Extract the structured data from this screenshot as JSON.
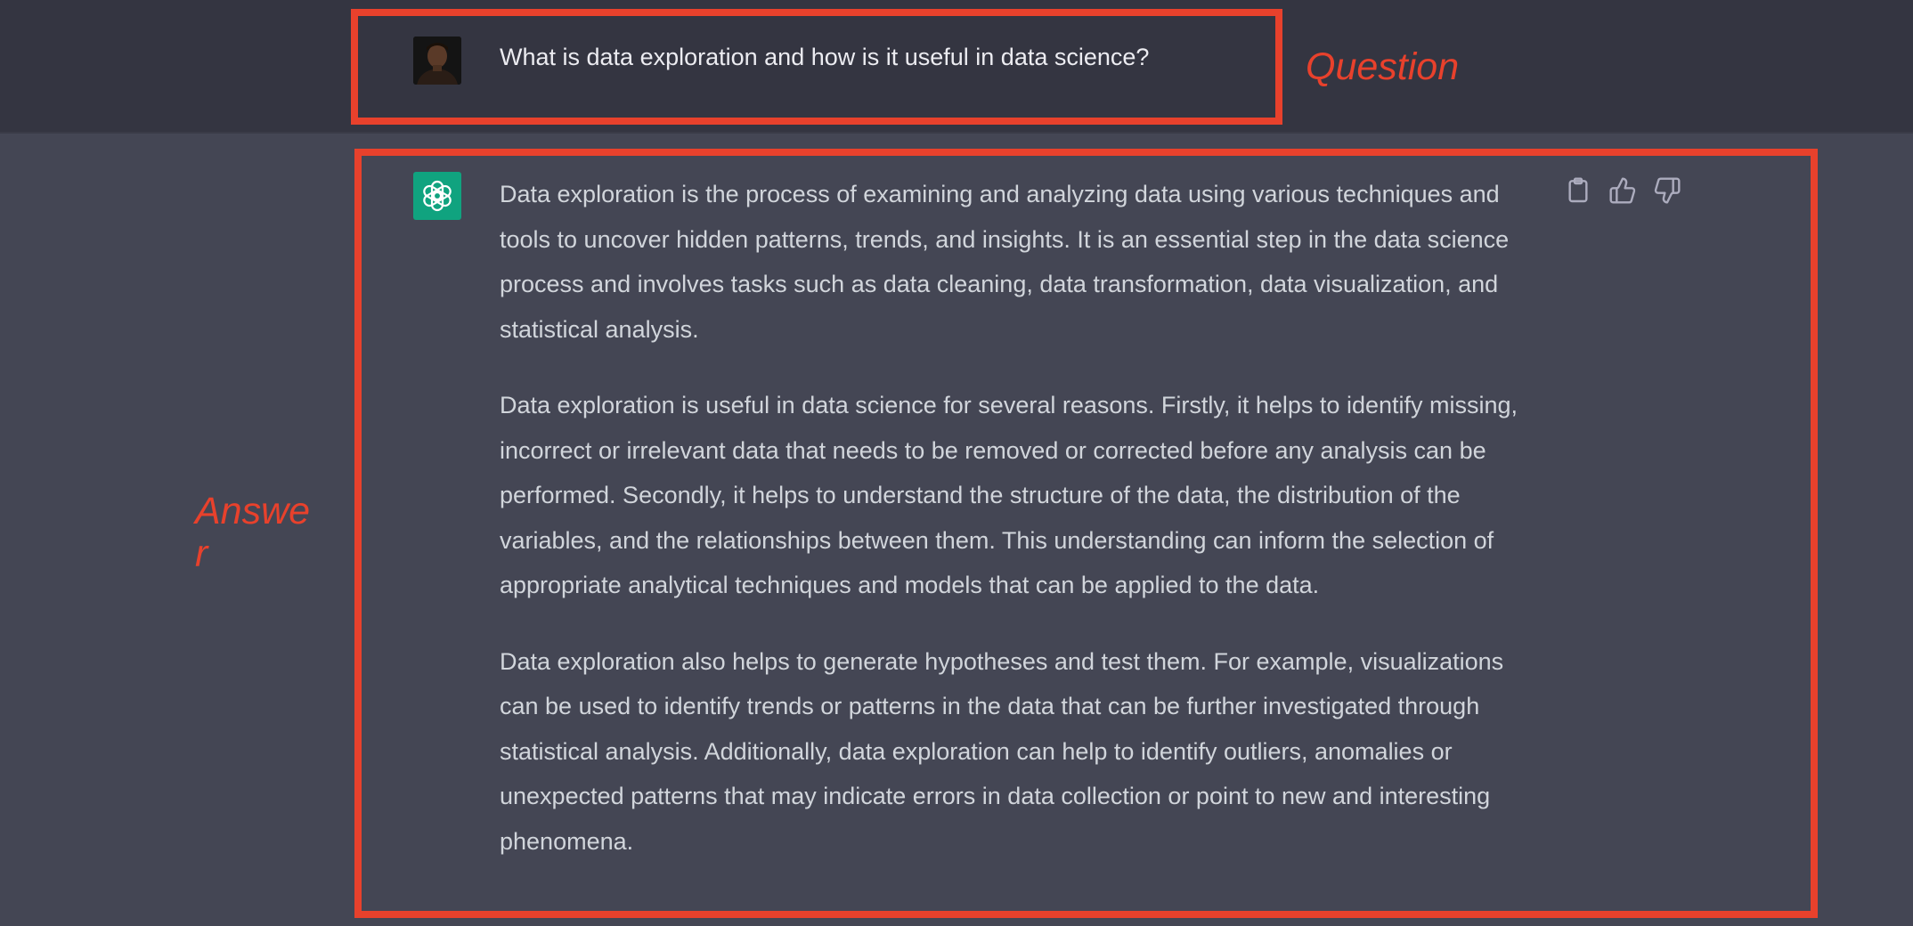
{
  "conversation": {
    "question": "What is data exploration and how is it useful in data science?",
    "answer_paragraphs": [
      "Data exploration is the process of examining and analyzing data using various techniques and tools to uncover hidden patterns, trends, and insights. It is an essential step in the data science process and involves tasks such as data cleaning, data transformation, data visualization, and statistical analysis.",
      "Data exploration is useful in data science for several reasons. Firstly, it helps to identify missing, incorrect or irrelevant data that needs to be removed or corrected before any analysis can be performed. Secondly, it helps to understand the structure of the data, the distribution of the variables, and the relationships between them. This understanding can inform the selection of appropriate analytical techniques and models that can be applied to the data.",
      "Data exploration also helps to generate hypotheses and test them. For example, visualizations can be used to identify trends or patterns in the data that can be further investigated through statistical analysis. Additionally, data exploration can help to identify outliers, anomalies or unexpected patterns that may indicate errors in data collection or point to new and interesting phenomena."
    ]
  },
  "actions": {
    "icons": [
      "clipboard-icon",
      "thumbs-up-icon",
      "thumbs-down-icon"
    ]
  },
  "annotations": {
    "question_label": "Question",
    "answer_label_line1": "Answe",
    "answer_label_line2": "r",
    "color": "#e8412c"
  },
  "colors": {
    "question_bg": "#343541",
    "answer_bg": "#444654",
    "assistant_brand": "#10a37f"
  }
}
